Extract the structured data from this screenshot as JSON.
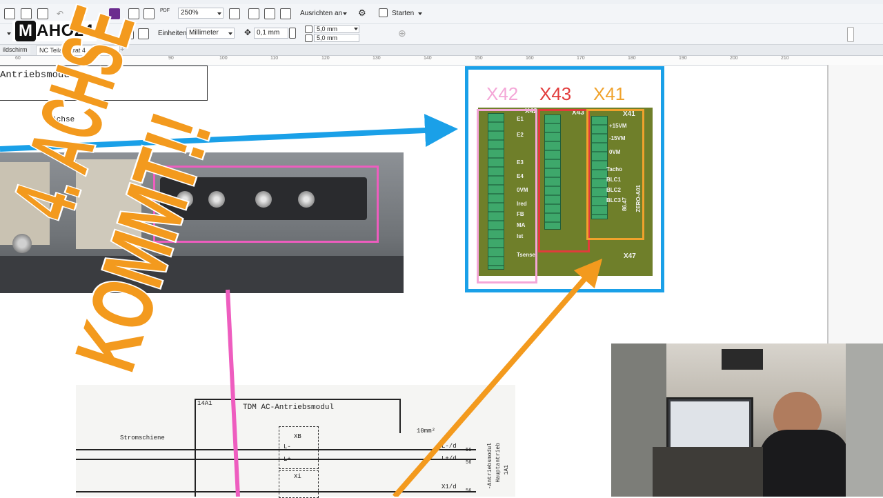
{
  "toolbar": {
    "zoom_value": "250%",
    "align_label": "Ausrichten an",
    "launch_label": "Starten",
    "units_label": "Einheiten:",
    "units_value": "Millimeter",
    "nudge_value": "0,1 mm",
    "dup_x": "5,0 mm",
    "dup_y": "5,0 mm",
    "pdf_label": "PDF"
  },
  "logo": {
    "initial": "M",
    "rest": "AHO24"
  },
  "tabs": [
    {
      "label": "ildschirm"
    },
    {
      "label": "NC Teilapparat 4. achs..."
    }
  ],
  "ruler": {
    "ticks": [
      "60",
      "70",
      "80",
      "90",
      "100",
      "110",
      "120",
      "130",
      "140",
      "150",
      "160",
      "170",
      "180",
      "190",
      "200",
      "210"
    ]
  },
  "document": {
    "title": "Antriebsmodul",
    "subtitle": "4.Achse"
  },
  "board": {
    "labels": [
      {
        "text": "X42",
        "color": "#f4a6d7"
      },
      {
        "text": "X43",
        "color": "#e23b3b"
      },
      {
        "text": "X41",
        "color": "#f0a22c"
      }
    ],
    "board_text": [
      "X42",
      "X43",
      "X41",
      "E1",
      "E2",
      "E3",
      "E4",
      "0VM",
      "Ired",
      "FB",
      "MA",
      "Ist",
      "Tsense",
      "Tacho",
      "BLC1",
      "BLC2",
      "BLC3",
      "+15VM",
      "-15VM",
      "0VM",
      "X47",
      "86.47",
      "ZERO-A01"
    ]
  },
  "schematic": {
    "box_id": "14A1",
    "heading": "TDM   AC-Antriebsmodul",
    "bus_label": "Stromschiene",
    "xb": "XB",
    "l1": "L-",
    "l2": "L+",
    "xi": "Xi",
    "wire": "10mm²",
    "out1": "L-/d",
    "out2": "L+/d",
    "out3": "X1/d",
    "n1": "56",
    "n2": "56",
    "n3": "56",
    "side1": "-Antriebsmodul",
    "side2": "Hauptantrieb",
    "side3": "1A1"
  },
  "overlay": {
    "line1": "4. ACHSE",
    "line2": "KOMMT!!",
    "fill": "#f39a1e",
    "stroke": "#ffffff"
  },
  "colors": {
    "accent_blue": "#1aa0e8",
    "pink": "#ee5dbf",
    "orange_arrow": "#f39a1e"
  }
}
